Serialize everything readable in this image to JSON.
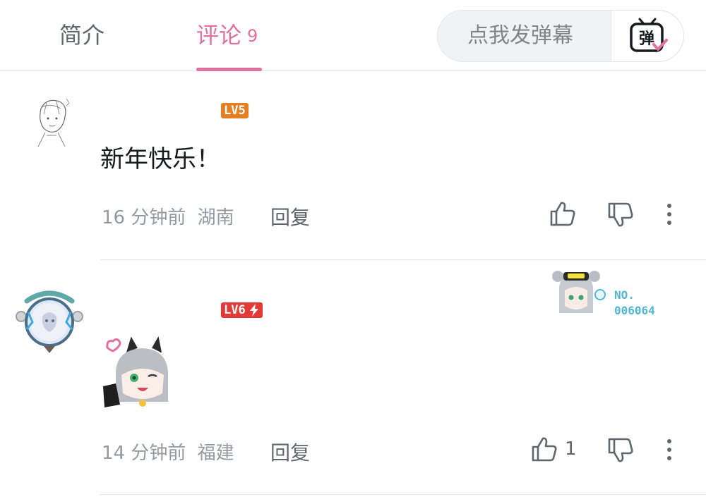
{
  "tabs": {
    "intro": "简介",
    "comments": "评论",
    "comments_count": "9"
  },
  "danmaku": {
    "placeholder": "点我发弹幕",
    "button_glyph": "弹"
  },
  "colors": {
    "accent_pink": "#e2709c",
    "level5": "#e67e22",
    "level6": "#e53935",
    "fan_blue": "#4fb8d6"
  },
  "comments": [
    {
      "level": "LV5",
      "text": "新年快乐！",
      "time": "16 分钟前",
      "location": "湖南",
      "reply": "回复",
      "likes": ""
    },
    {
      "level": "LV6",
      "level_icon": "lightning-icon",
      "sticker": "anime-girl-sticker",
      "time": "14 分钟前",
      "location": "福建",
      "reply": "回复",
      "likes": "1",
      "fan_card": {
        "line1": "NO.",
        "line2": "006064"
      }
    }
  ]
}
